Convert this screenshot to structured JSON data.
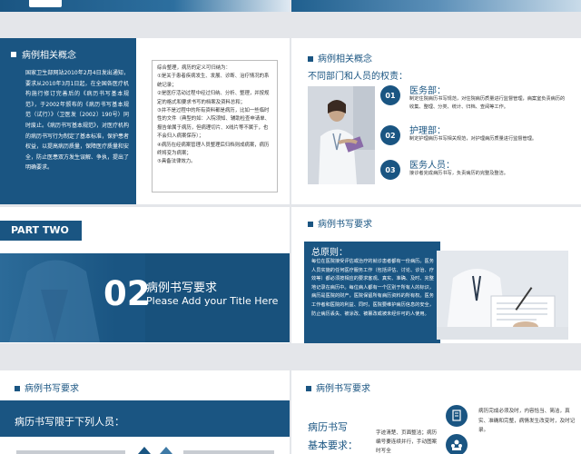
{
  "colors": {
    "primary": "#1a5582",
    "dark": "#164a72",
    "light": "#dfe9f2",
    "white": "#ffffff"
  },
  "slide1": {
    "heading": "病例相关概念",
    "body": "国家卫生部网站2010年2月4日发出通知，要求从2010年3月1日起，在全国各医疗机构施行修订完善后的《病历书写基本规范》，于2002年颁布的《病历书写基本规范（试行）》（卫医发〔2002〕190号）同时废止。《病历书写基本规范》，对医疗机构的病历书写行为制定了基本标准，保护患者权益，以提高病历质量，保障医疗质量和安全，防止医患双方发生误解、争执，提出了明确要求。",
    "box_lines": [
      "综合整理，病历的定义可归纳为：",
      "①是关于患者疾病发生、发展、诊断、治疗情况的系统记录；",
      "②是医疗活动过程中经过归纳、分析、整理，并按规定的格式和要求书写的档案及资料总和；",
      "③并不是过程中的所有资料都是病历，比如一些临时性的文件（典型的如：入院须知、辅助检查申请单、报告单属于病历，但病理切片、X线片等不属于，也不会归入病案保存）；",
      "④病历在经病案管理人员整理后归档则成病案，病历终将变为病案；",
      "⑤具备法律效力。"
    ]
  },
  "slide2": {
    "heading": "病例相关概念",
    "subheading": "不同部门和人员的权责：",
    "items": [
      {
        "num": "01",
        "title": "医务部：",
        "desc": "制定住院病历书写规范，对住院病历质量进行监督管理，病案室负责病历的收集、整理、分类、统计、归档、查阅等工作。"
      },
      {
        "num": "02",
        "title": "护理部：",
        "desc": "制定护理病历书写相关规范，对护理病历质量进行监督管理。"
      },
      {
        "num": "03",
        "title": "医务人员：",
        "desc": "接诊者完成病历书写，负责病历的完整及整洁。"
      }
    ]
  },
  "slide3": {
    "part": "PART TWO",
    "number": "02",
    "title": "病例书写要求",
    "subtitle": "Please Add your Title Here"
  },
  "slide4": {
    "heading": "病例书写要求",
    "principle_title": "总原则：",
    "principle_body": "每位在医院接受评估或治疗的就诊患者都有一份病历。医务人员实施的任何医疗服务工作（包括评估、讨论、诊治、疗效等）都必须按相应的要求客观、真实、准确、及时、完整地记录在病历中。每位病人都有一个区别于所有人的标识，病历是医院的财产，医院保留所有病历资料的所有权。医务工作者和医院的利益、同时，医院要维护病历信息的安全，防止病历丢失、被涂改、被篡改或被未经许可的人使用。"
  },
  "slide5": {
    "heading": "病例书写要求",
    "subheading": "病历书写限于下列人员："
  },
  "slide6": {
    "heading": "病例书写要求",
    "label_line1": "病历书写",
    "label_line2": "基本要求：",
    "mid_text": "字迹清楚、页面整洁；病历编号要连续并行，手动图案时写全",
    "right_text": "病历完成必须及时，内容恰当、简洁，真实、准确和完整，病情发生改变时，及时记录。"
  }
}
